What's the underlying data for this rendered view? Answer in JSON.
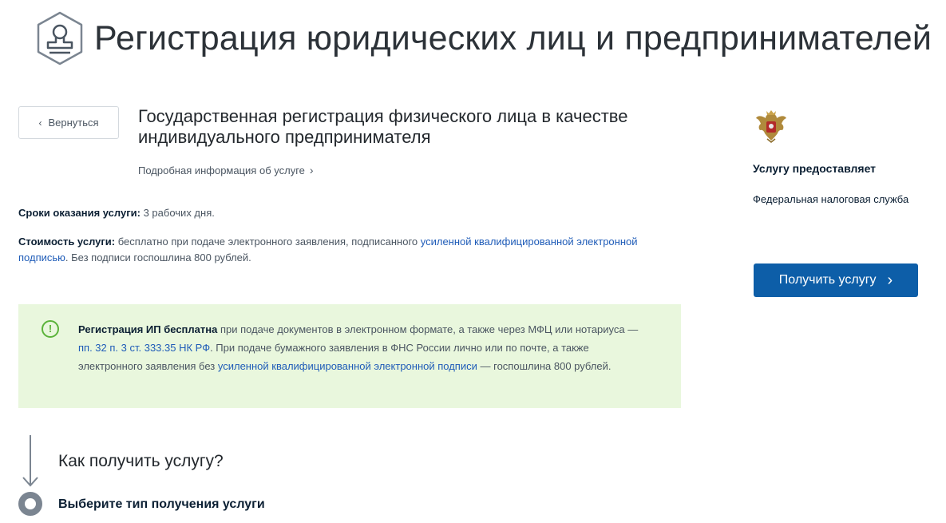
{
  "header": {
    "title": "Регистрация юридических лиц и предпринимателей",
    "icon": "stamp-icon"
  },
  "nav": {
    "back_label": "Вернуться",
    "back_icon": "chevron-left-icon"
  },
  "service": {
    "title": "Государственная регистрация физического лица в качестве индивидуального предпринимателя",
    "more_info": "Подробная информация об услуге",
    "terms_label": "Сроки оказания услуги:",
    "terms_value": "3 рабочих дня.",
    "cost_label": "Стоимость услуги:",
    "cost_text_1": "бесплатно при подаче электронного заявления, подписанного",
    "cost_link": "усиленной квалифицированной электронной подписью",
    "cost_text_2": ". Без подписи госпошлина 800 рублей."
  },
  "notice": {
    "icon": "exclamation-circle-icon",
    "bold": "Регистрация ИП бесплатна",
    "text_1": "при подаче документов в электронном формате, а также через МФЦ или нотариуса —",
    "link_1": "пп. 32 п. 3 ст. 333.35 НК РФ",
    "text_2": ". При подаче бумажного заявления в ФНС России лично или по почте, а также электронного заявления без",
    "link_2": "усиленной квалифицированной электронной подписи",
    "text_3": "— госпошлина 800 рублей."
  },
  "howto": {
    "title": "Как получить услугу?",
    "step_1": "Выберите тип получения услуги"
  },
  "sidebar": {
    "emblem": "russian-emblem-icon",
    "provider_heading": "Услугу предоставляет",
    "provider_name": "Федеральная налоговая служба",
    "get_service_label": "Получить услугу"
  },
  "colors": {
    "link": "#1f5cb8",
    "button": "#0d5ea8",
    "notice_bg": "#e9f7dd",
    "notice_icon": "#5bb33a"
  }
}
